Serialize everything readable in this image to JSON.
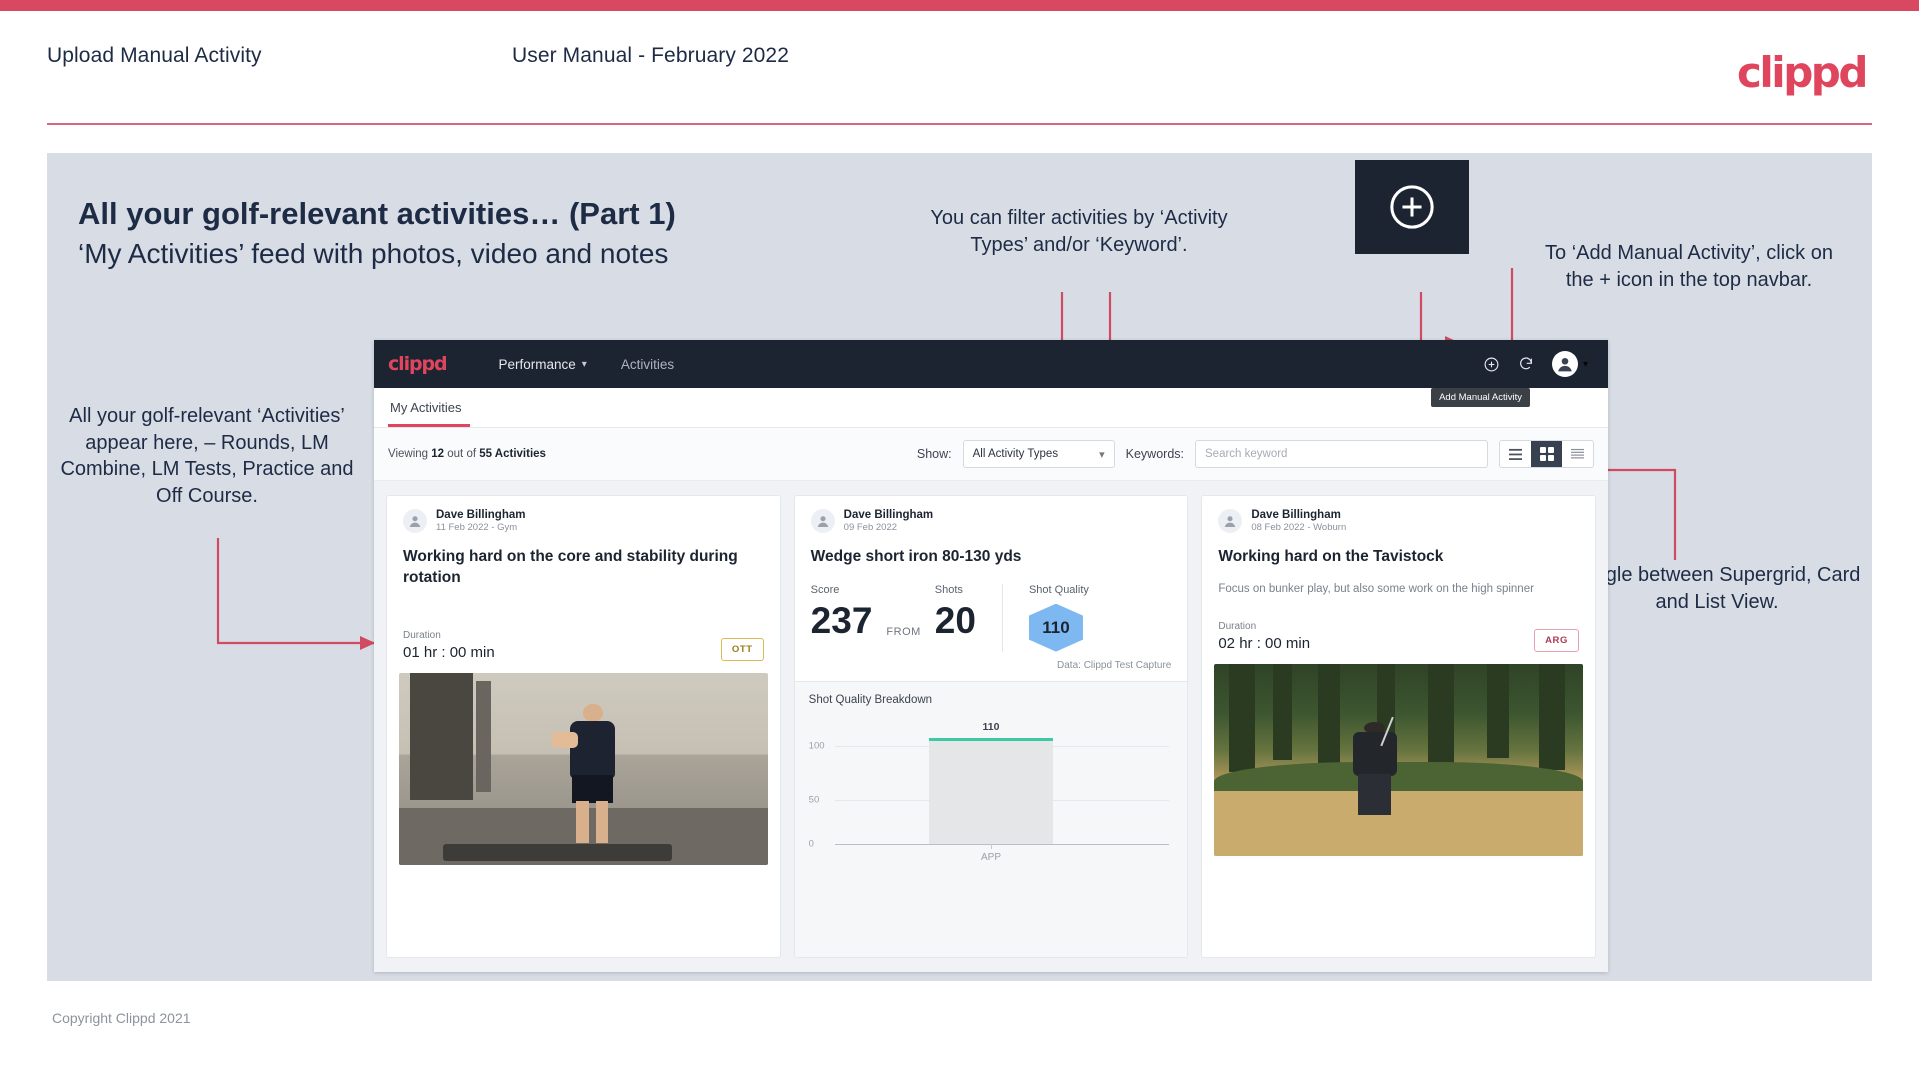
{
  "slide": {
    "header_title": "Upload Manual Activity",
    "header_subtitle": "User Manual - February 2022",
    "brand_logo": "clippd",
    "heading": "All your golf-relevant activities… (Part 1)",
    "subheading": "‘My Activities’ feed with photos, video and notes",
    "footer": "Copyright Clippd 2021",
    "accent_color": "#d94861",
    "panel_color": "#d8dde5",
    "ink_color": "#1d2b45"
  },
  "callouts": {
    "filter": "You can filter activities by ‘Activity Types’ and/or ‘Keyword’.",
    "add_manual": "To ‘Add Manual Activity’, click on the + icon in the top navbar.",
    "activities_feed": "All your golf-relevant ‘Activities’ appear here, – Rounds, LM Combine, LM Tests, Practice and Off Course.",
    "toggle_views": "Toggle between Supergrid, Card and List View."
  },
  "add_box": {
    "icon": "plus-circle-icon"
  },
  "app": {
    "navbar": {
      "logo": "clippd",
      "links": [
        {
          "label": "Performance",
          "has_chevron": true
        },
        {
          "label": "Activities",
          "has_chevron": false
        }
      ],
      "icons": [
        "plus-circle-icon",
        "refresh-icon",
        "user-avatar-icon",
        "chevron-down-icon"
      ],
      "tooltip": "Add Manual Activity"
    },
    "tabs": [
      {
        "label": "My Activities",
        "active": true
      }
    ],
    "filters": {
      "viewing_prefix": "Viewing ",
      "viewing_count": "12",
      "viewing_mid": " out of ",
      "viewing_total": "55 Activities",
      "show_label": "Show:",
      "activity_type_value": "All Activity Types",
      "keywords_label": "Keywords:",
      "search_placeholder": "Search keyword",
      "view_modes": [
        "list-view-icon",
        "supergrid-view-icon",
        "card-view-icon"
      ],
      "active_view_mode": "supergrid-view-icon"
    },
    "cards": [
      {
        "author": "Dave Billingham",
        "meta": "11 Feb 2022 - Gym",
        "title": "Working hard on the core and stability during rotation",
        "duration_label": "Duration",
        "duration_value": "01 hr : 00 min",
        "badge": "OTT",
        "photo": "gym-video-thumbnail"
      },
      {
        "author": "Dave Billingham",
        "meta": "09 Feb 2022",
        "title": "Wedge short iron 80-130 yds",
        "score_label": "Score",
        "score_value": "237",
        "from_label": "FROM",
        "shots_label": "Shots",
        "shots_value": "20",
        "shot_quality_label": "Shot Quality",
        "shot_quality_value": "110",
        "data_source": "Data: Clippd Test Capture",
        "chart_title": "Shot Quality Breakdown"
      },
      {
        "author": "Dave Billingham",
        "meta": "08 Feb 2022 - Woburn",
        "title": "Working hard on the Tavistock",
        "description": "Focus on bunker play, but also some work on the high spinner",
        "duration_label": "Duration",
        "duration_value": "02 hr : 00 min",
        "badge": "ARG",
        "photo": "golf-bunker-photo"
      }
    ]
  },
  "chart_data": {
    "type": "bar",
    "title": "Shot Quality Breakdown",
    "categories": [
      "APP"
    ],
    "values": [
      110
    ],
    "data_labels": [
      "110"
    ],
    "xlabel": "",
    "ylabel": "",
    "ylim": [
      0,
      120
    ],
    "yticks": [
      0,
      50,
      100
    ],
    "ytick_labels": [
      "0",
      "50",
      "100"
    ],
    "grid": true,
    "legend": false,
    "bar_color": "#e4e6e8",
    "bar_cap_color": "#3fc8a4"
  }
}
